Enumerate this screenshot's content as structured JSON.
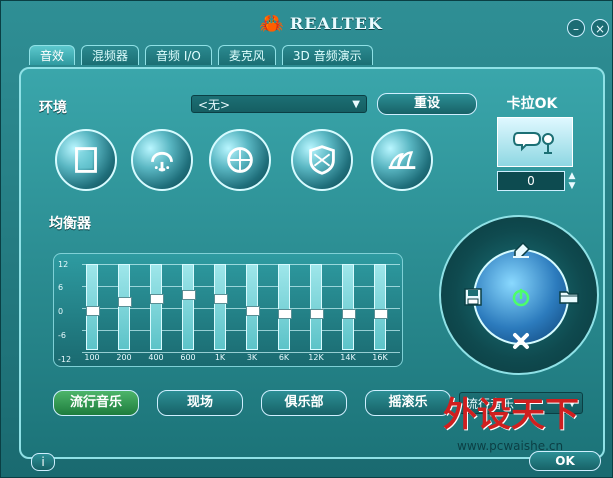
{
  "brand": {
    "logo_text": "REALTEK"
  },
  "tabs": [
    {
      "label": "音效"
    },
    {
      "label": "混频器"
    },
    {
      "label": "音频 I/O"
    },
    {
      "label": "麦克风"
    },
    {
      "label": "3D 音频演示"
    }
  ],
  "environment": {
    "title": "环境",
    "selected": "<无>",
    "reset_label": "重设"
  },
  "karaoke": {
    "title": "卡拉OK",
    "value": "0"
  },
  "equalizer": {
    "title": "均衡器",
    "scale": [
      "12",
      "6",
      "0",
      "-6",
      "-12"
    ],
    "bands": [
      {
        "label": "100",
        "value": -1
      },
      {
        "label": "200",
        "value": 2
      },
      {
        "label": "400",
        "value": 3
      },
      {
        "label": "600",
        "value": 4
      },
      {
        "label": "1K",
        "value": 3
      },
      {
        "label": "3K",
        "value": -1
      },
      {
        "label": "6K",
        "value": -2
      },
      {
        "label": "12K",
        "value": -2
      },
      {
        "label": "14K",
        "value": -2
      },
      {
        "label": "16K",
        "value": -2
      }
    ]
  },
  "presets": {
    "buttons": [
      {
        "label": "流行音乐"
      },
      {
        "label": "现场"
      },
      {
        "label": "俱乐部"
      },
      {
        "label": "摇滚乐"
      }
    ],
    "select_value": "流行音乐"
  },
  "footer": {
    "ok_label": "OK"
  },
  "watermark": {
    "text": "外设天下",
    "url": "www.pcwaishe.cn"
  }
}
